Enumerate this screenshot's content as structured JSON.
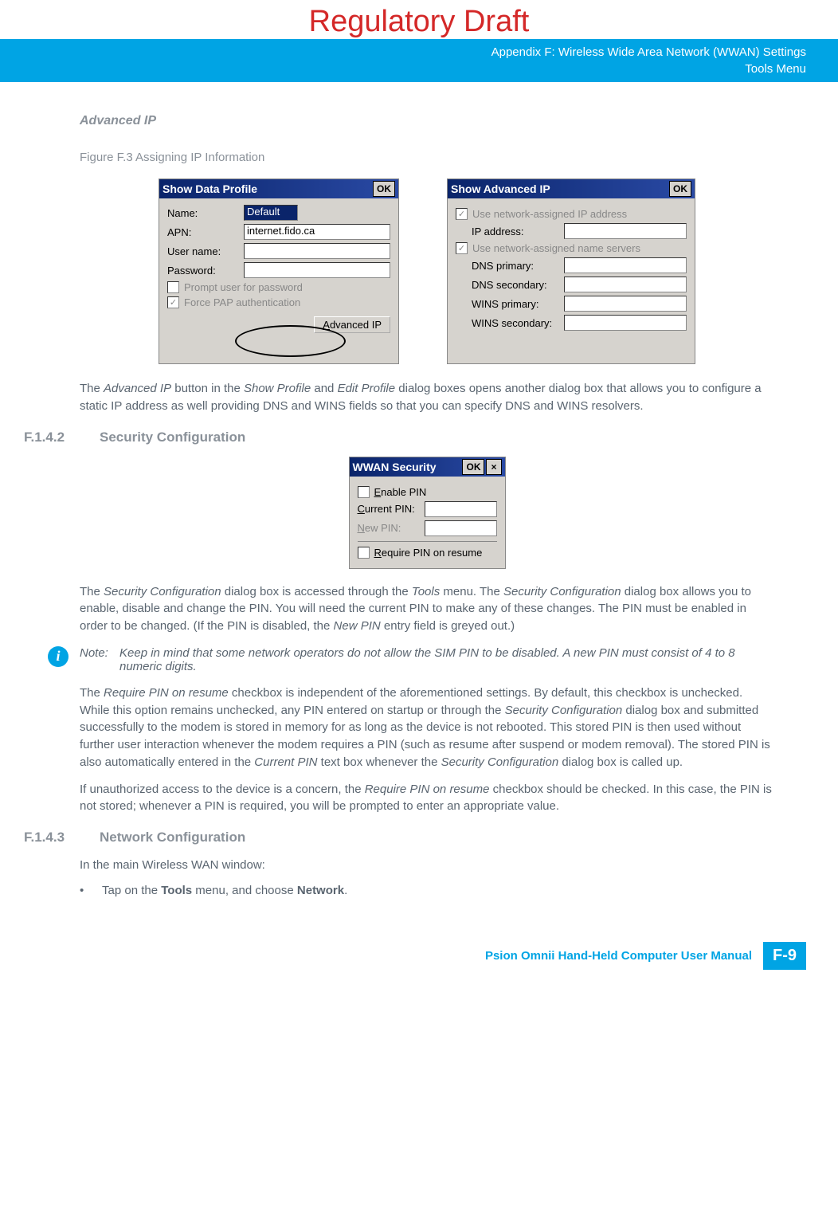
{
  "watermark": "Regulatory Draft",
  "header": {
    "line1": "Appendix F: Wireless Wide Area Network (WWAN) Settings",
    "line2": "Tools Menu"
  },
  "advanced_ip_title": "Advanced IP",
  "figure_caption": "Figure F.3     Assigning IP Information",
  "dialog1": {
    "title": "Show Data Profile",
    "ok": "OK",
    "name_label": "Name:",
    "name_value": "Default",
    "apn_label": "APN:",
    "apn_value": "internet.fido.ca",
    "user_label": "User name:",
    "pass_label": "Password:",
    "prompt": "Prompt user for password",
    "force": "Force PAP authentication",
    "adv_btn": "Advanced IP"
  },
  "dialog2": {
    "title": "Show Advanced IP",
    "ok": "OK",
    "use_ip": "Use network-assigned IP address",
    "ip_addr": "IP address:",
    "use_name": "Use network-assigned name servers",
    "dns_p": "DNS primary:",
    "dns_s": "DNS secondary:",
    "wins_p": "WINS primary:",
    "wins_s": "WINS secondary:"
  },
  "para_adv_ip_1": "The ",
  "para_adv_ip_2": "Advanced IP",
  "para_adv_ip_3": " button in the ",
  "para_adv_ip_4": "Show Profile",
  "para_adv_ip_5": " and ",
  "para_adv_ip_6": "Edit Profile",
  "para_adv_ip_7": " dialog boxes opens another dialog box that allows you to configure a static IP address as well providing DNS and WINS fields so that you can specify DNS and WINS resolvers.",
  "sec_config": {
    "num": "F.1.4.2",
    "title": "Security Configuration"
  },
  "dialog3": {
    "title": "WWAN Security",
    "ok": "OK",
    "close": "×",
    "enable": "Enable PIN",
    "current": "Current PIN:",
    "new": "New PIN:",
    "require": "Require PIN on resume"
  },
  "para_sec_1a": "The ",
  "para_sec_1b": "Security Configuration",
  "para_sec_1c": " dialog box is accessed through the ",
  "para_sec_1d": "Tools",
  "para_sec_1e": " menu. The ",
  "para_sec_1f": "Security Configuration",
  "para_sec_1g": " dialog box allows you to enable, disable and change the PIN. You will need the current PIN to make any of these changes. The PIN must be enabled in order to be changed. (If the PIN is disabled, the ",
  "para_sec_1h": "New PIN",
  "para_sec_1i": " entry field is greyed out.)",
  "note": {
    "icon": "i",
    "label": "Note:",
    "text": "Keep in mind that some network operators do not allow the SIM PIN to be disabled. A new PIN must consist of 4 to 8 numeric digits."
  },
  "para_sec_2a": "The ",
  "para_sec_2b": "Require PIN on resume",
  "para_sec_2c": " checkbox is independent of the aforementioned settings. By default, this checkbox is unchecked. While this option remains unchecked, any PIN entered on startup or through the ",
  "para_sec_2d": "Security Configuration",
  "para_sec_2e": " dialog box and submitted successfully to the modem is stored in memory for as long as the device is not rebooted. This stored PIN is then used without further user interaction whenever the modem requires a PIN (such as resume after suspend or modem removal). The stored PIN is also automatically entered in the ",
  "para_sec_2f": "Current PIN",
  "para_sec_2g": " text box whenever the ",
  "para_sec_2h": "Security Configuration",
  "para_sec_2i": " dialog box is called up.",
  "para_sec_3a": "If unauthorized access to the device is a concern, the ",
  "para_sec_3b": "Require PIN on resume",
  "para_sec_3c": " checkbox should be checked. In this case, the PIN is not stored; whenever a PIN is required, you will be prompted to enter an appropriate value.",
  "net_config": {
    "num": "F.1.4.3",
    "title": "Network Configuration"
  },
  "para_net_1": "In the main Wireless WAN window:",
  "bullet_1a": "Tap on the ",
  "bullet_1b": "Tools",
  "bullet_1c": " menu, and choose ",
  "bullet_1d": "Network",
  "bullet_1e": ".",
  "footer": {
    "text": "Psion Omnii Hand-Held Computer User Manual",
    "page": "F-9"
  }
}
